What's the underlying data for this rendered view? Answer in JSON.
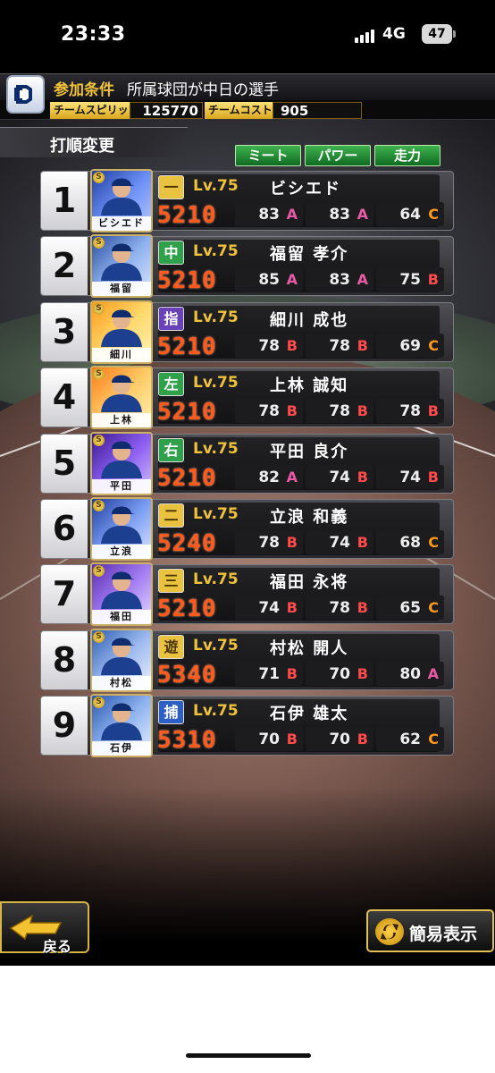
{
  "status_bar": {
    "time": "23:33",
    "network": "4G",
    "battery": "47"
  },
  "condition": {
    "label": "参加条件",
    "text": "所属球団が中日の選手"
  },
  "team": {
    "spirit_label": "チームスピリッツ",
    "spirit_value": "125770",
    "cost_label": "チームコスト",
    "cost_value": "905"
  },
  "section_title": "打順変更",
  "sort_buttons": {
    "meet": "ミート",
    "power": "パワー",
    "speed": "走力"
  },
  "lineup": [
    {
      "order": "1",
      "card_name": "ビシエド",
      "position": "一",
      "level": "Lv.75",
      "name": "ビシエド",
      "power": "5210",
      "meet": "83",
      "meet_grade": "A",
      "pow": "83",
      "pow_grade": "A",
      "spd": "64",
      "spd_grade": "C"
    },
    {
      "order": "2",
      "card_name": "福留",
      "position": "中",
      "level": "Lv.75",
      "name": "福留 孝介",
      "power": "5210",
      "meet": "85",
      "meet_grade": "A",
      "pow": "83",
      "pow_grade": "A",
      "spd": "75",
      "spd_grade": "B"
    },
    {
      "order": "3",
      "card_name": "細川",
      "position": "指",
      "level": "Lv.75",
      "name": "細川 成也",
      "power": "5210",
      "meet": "78",
      "meet_grade": "B",
      "pow": "78",
      "pow_grade": "B",
      "spd": "69",
      "spd_grade": "C"
    },
    {
      "order": "4",
      "card_name": "上林",
      "position": "左",
      "level": "Lv.75",
      "name": "上林 誠知",
      "power": "5210",
      "meet": "78",
      "meet_grade": "B",
      "pow": "78",
      "pow_grade": "B",
      "spd": "78",
      "spd_grade": "B"
    },
    {
      "order": "5",
      "card_name": "平田",
      "position": "右",
      "level": "Lv.75",
      "name": "平田 良介",
      "power": "5210",
      "meet": "82",
      "meet_grade": "A",
      "pow": "74",
      "pow_grade": "B",
      "spd": "74",
      "spd_grade": "B"
    },
    {
      "order": "6",
      "card_name": "立浪",
      "position": "二",
      "level": "Lv.75",
      "name": "立浪 和義",
      "power": "5240",
      "meet": "78",
      "meet_grade": "B",
      "pow": "74",
      "pow_grade": "B",
      "spd": "68",
      "spd_grade": "C"
    },
    {
      "order": "7",
      "card_name": "福田",
      "position": "三",
      "level": "Lv.75",
      "name": "福田 永将",
      "power": "5210",
      "meet": "74",
      "meet_grade": "B",
      "pow": "78",
      "pow_grade": "B",
      "spd": "65",
      "spd_grade": "C"
    },
    {
      "order": "8",
      "card_name": "村松",
      "position": "遊",
      "level": "Lv.75",
      "name": "村松 開人",
      "power": "5340",
      "meet": "71",
      "meet_grade": "B",
      "pow": "70",
      "pow_grade": "B",
      "spd": "80",
      "spd_grade": "A"
    },
    {
      "order": "9",
      "card_name": "石伊",
      "position": "捕",
      "level": "Lv.75",
      "name": "石伊 雄太",
      "power": "5310",
      "meet": "70",
      "meet_grade": "B",
      "pow": "70",
      "pow_grade": "B",
      "spd": "62",
      "spd_grade": "C"
    }
  ],
  "footer": {
    "back_label": "戻る",
    "simple_view_label": "簡易表示"
  },
  "colors": {
    "grade_A": "#e65aa6",
    "grade_B": "#ff4b4b",
    "grade_C": "#ff9a1a",
    "power_text": "#ff5a1c",
    "gold": "#f0c23a"
  }
}
